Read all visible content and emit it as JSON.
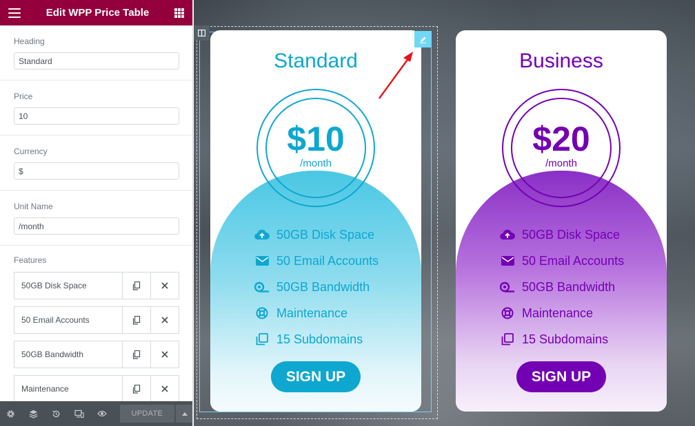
{
  "panel": {
    "title": "Edit WPP Price Table",
    "fields": [
      {
        "label": "Heading",
        "value": "Standard"
      },
      {
        "label": "Price",
        "value": "10"
      },
      {
        "label": "Currency",
        "value": "$"
      },
      {
        "label": "Unit Name",
        "value": "/month"
      }
    ],
    "features_label": "Features",
    "features": [
      "50GB Disk Space",
      "50 Email Accounts",
      "50GB Bandwidth",
      "Maintenance"
    ],
    "footer": {
      "update_label": "UPDATE"
    }
  },
  "cards": [
    {
      "title": "Standard",
      "price": "$10",
      "unit": "/month",
      "accent": "#0ea7d0",
      "features": [
        {
          "icon": "cloud-upload-icon",
          "label": "50GB Disk Space"
        },
        {
          "icon": "envelope-icon",
          "label": "50 Email Accounts"
        },
        {
          "icon": "tape-icon",
          "label": "50GB Bandwidth"
        },
        {
          "icon": "life-ring-icon",
          "label": "Maintenance"
        },
        {
          "icon": "copy-icon",
          "label": "15 Subdomains"
        }
      ],
      "button": "SIGN UP"
    },
    {
      "title": "Business",
      "price": "$20",
      "unit": "/month",
      "accent": "#7300b3",
      "features": [
        {
          "icon": "cloud-upload-icon",
          "label": "50GB Disk Space"
        },
        {
          "icon": "envelope-icon",
          "label": "50 Email Accounts"
        },
        {
          "icon": "tape-icon",
          "label": "50GB Bandwidth"
        },
        {
          "icon": "life-ring-icon",
          "label": "Maintenance"
        },
        {
          "icon": "copy-icon",
          "label": "15 Subdomains"
        }
      ],
      "button": "SIGN UP"
    }
  ],
  "colors": {
    "header": "#93003c",
    "footer": "#495157",
    "editor_highlight": "#71d7f7",
    "annotation_arrow": "#e8111c"
  }
}
